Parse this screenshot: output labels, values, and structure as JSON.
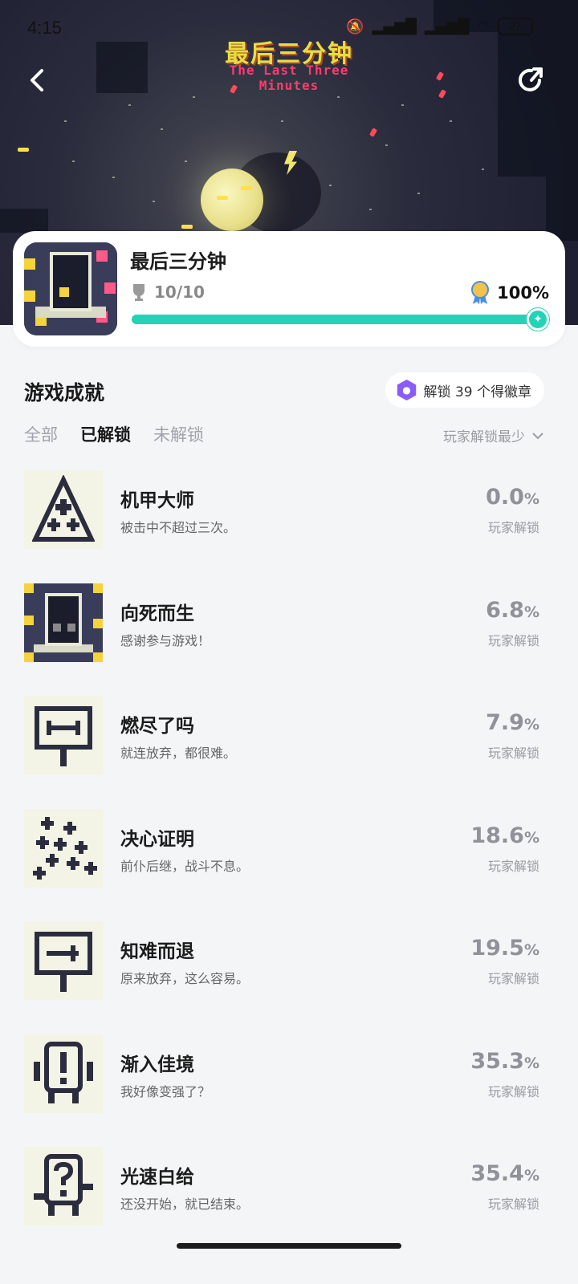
{
  "status_bar": {
    "time": "4:15",
    "battery": "27"
  },
  "hero": {
    "title": "最后三分钟",
    "subtitle": "The Last Three Minutes"
  },
  "game": {
    "name": "最后三分钟",
    "trophies": "10/10",
    "completion": "100%",
    "progress_fraction": 1.0
  },
  "section": {
    "title": "游戏成就",
    "badge_text": "解锁 39 个得徽章"
  },
  "tabs": [
    {
      "label": "全部",
      "active": false
    },
    {
      "label": "已解锁",
      "active": true
    },
    {
      "label": "未解锁",
      "active": false
    }
  ],
  "sort_label": "玩家解锁最少",
  "achievements": [
    {
      "name": "机甲大师",
      "desc": "被击中不超过三次。",
      "pct": "0.0",
      "unit": "%",
      "label": "玩家解锁",
      "icon": "triangle-crosses-icon"
    },
    {
      "name": "向死而生",
      "desc": "感谢参与游戏！",
      "pct": "6.8",
      "unit": "%",
      "label": "玩家解锁",
      "icon": "pixel-robot-icon"
    },
    {
      "name": "燃尽了吗",
      "desc": "就连放弃，都很难。",
      "pct": "7.9",
      "unit": "%",
      "label": "玩家解锁",
      "icon": "sign-double-arrow-icon"
    },
    {
      "name": "决心证明",
      "desc": "前仆后继，战斗不息。",
      "pct": "18.6",
      "unit": "%",
      "label": "玩家解锁",
      "icon": "cross-pyramid-icon"
    },
    {
      "name": "知难而退",
      "desc": "原来放弃，这么容易。",
      "pct": "19.5",
      "unit": "%",
      "label": "玩家解锁",
      "icon": "sign-arrow-icon"
    },
    {
      "name": "渐入佳境",
      "desc": "我好像变强了？",
      "pct": "35.3",
      "unit": "%",
      "label": "玩家解锁",
      "icon": "exclamation-robot-icon"
    },
    {
      "name": "光速白给",
      "desc": "还没开始，就已结束。",
      "pct": "35.4",
      "unit": "%",
      "label": "玩家解锁",
      "icon": "question-robot-icon"
    }
  ]
}
